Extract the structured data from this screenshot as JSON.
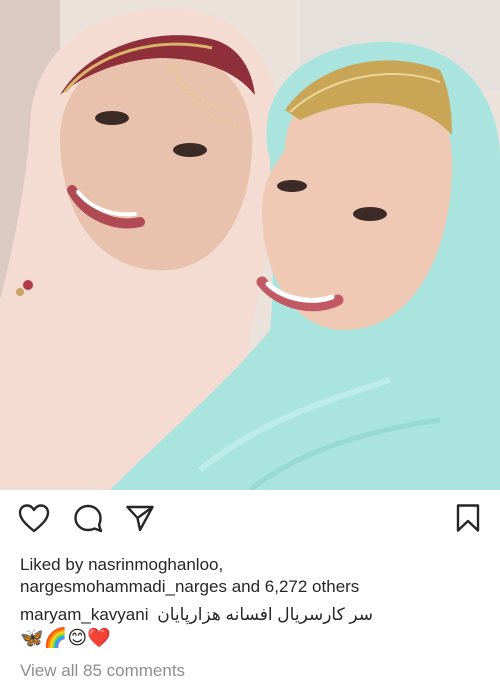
{
  "post": {
    "image_alt": "Selfie of two women wearing headscarves, one pink with a jeweled headband and one turquoise with a gold embroidered headband"
  },
  "actions": {
    "like_icon": "heart-icon",
    "comment_icon": "comment-bubble-icon",
    "share_icon": "paper-plane-icon",
    "save_icon": "bookmark-icon"
  },
  "likes": {
    "prefix": "Liked by",
    "user1": "nasrinmoghanloo,",
    "user2": "nargesmohammadi_narges",
    "joiner": "and",
    "others": "6,272 others"
  },
  "caption": {
    "username": "maryam_kavyani",
    "text": "سر کارسریال افسانه هزارپایان",
    "emojis": "🦋🌈😊❤️"
  },
  "comments": {
    "view_all": "View all 85 comments"
  },
  "colors": {
    "text": "#262626",
    "muted": "#8e8e8e",
    "pink_scarf": "#f3d6cc",
    "turquoise_scarf": "#a9e3de"
  }
}
